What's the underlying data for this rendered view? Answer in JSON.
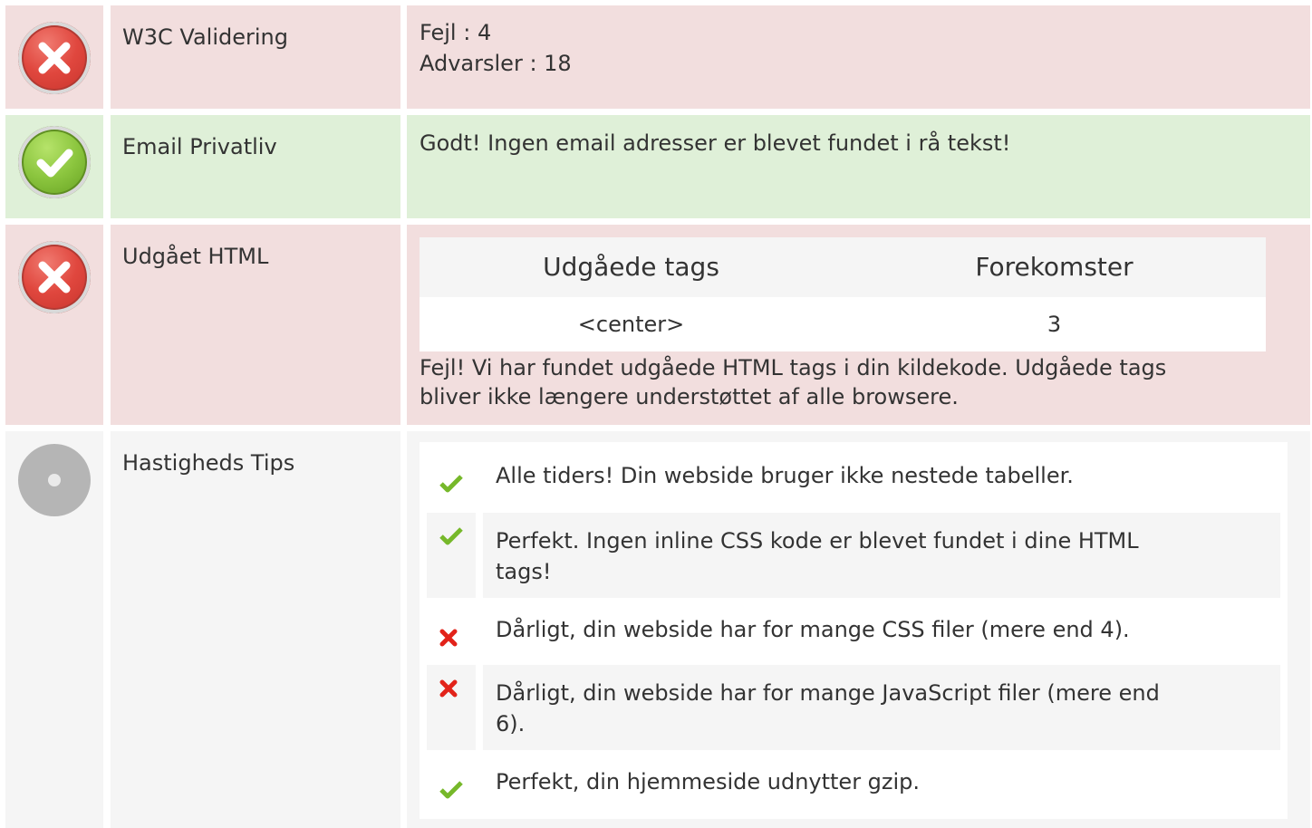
{
  "rows": {
    "w3c": {
      "label": "W3C Validering",
      "errors": "Fejl : 4",
      "warnings": "Advarsler : 18"
    },
    "email": {
      "label": "Email Privatliv",
      "text": "Godt! Ingen email adresser er blevet fundet i rå tekst!"
    },
    "deprecated": {
      "label": "Udgået HTML",
      "table_headers": [
        "Udgåede tags",
        "Forekomster"
      ],
      "table_rows": [
        [
          "<center>",
          "3"
        ]
      ],
      "text_line1": "Fejl! Vi har fundet udgåede HTML tags i din kildekode. Udgåede tags",
      "text_line2": "bliver ikke længere understøttet af alle browsere."
    },
    "speed": {
      "label": "Hastigheds Tips",
      "tips": [
        {
          "status": "ok",
          "line1": "Alle tiders! Din webside bruger ikke nestede tabeller.",
          "line2": ""
        },
        {
          "status": "ok",
          "line1": "Perfekt. Ingen inline CSS kode er blevet fundet i dine HTML",
          "line2": "tags!"
        },
        {
          "status": "bad",
          "line1": "Dårligt, din webside har for mange CSS filer (mere end 4).",
          "line2": ""
        },
        {
          "status": "bad",
          "line1": "Dårligt, din webside har for mange JavaScript filer (mere end",
          "line2": "6)."
        },
        {
          "status": "ok",
          "line1": "Perfekt, din hjemmeside udnytter gzip.",
          "line2": ""
        }
      ]
    }
  },
  "colors": {
    "error_bg": "#f2dede",
    "success_bg": "#dff0d8",
    "neutral_bg": "#f5f5f5",
    "check_green": "#76b82a",
    "cross_red": "#e2231a"
  },
  "icons": {
    "w3c": "error-circle-icon",
    "email": "success-circle-icon",
    "deprecated": "error-circle-icon",
    "speed": "neutral-circle-icon",
    "tip_ok": "check-icon",
    "tip_bad": "cross-icon"
  }
}
